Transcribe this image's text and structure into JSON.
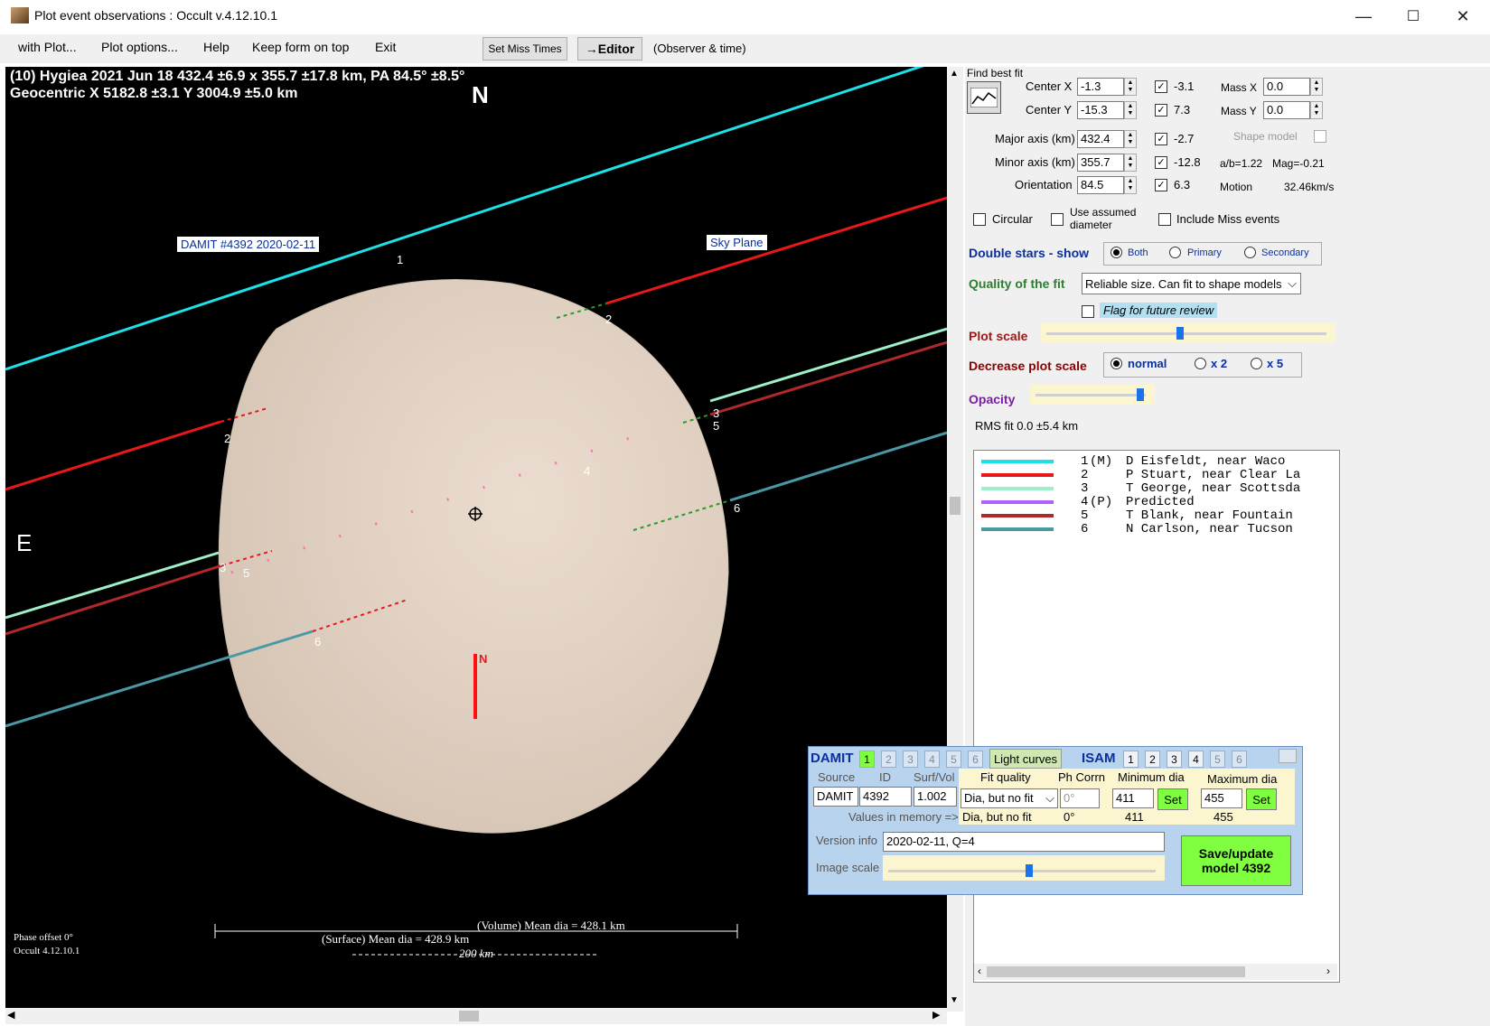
{
  "window": {
    "title": "Plot event observations : Occult v.4.12.10.1",
    "controls": [
      "—",
      "☐",
      "✕"
    ]
  },
  "menu": {
    "items": [
      "with Plot...",
      "Plot options...",
      "Help",
      "Keep form on top",
      "Exit"
    ],
    "set_miss_times": "Set Miss Times",
    "editor": "→Editor",
    "observer_time": "(Observer & time)"
  },
  "plot": {
    "header_line1": "(10) Hygiea  2021 Jun 18   432.4 ±6.9 x 355.7 ±17.8 km, PA 84.5° ±8.5°",
    "header_line2": "Geocentric  X  5182.8 ±3.1  Y 3004.9 ±5.0 km",
    "north": "N",
    "east": "E",
    "damit_label": "DAMIT #4392 2020-02-11",
    "sky_plane_label": "Sky Plane",
    "chord_labels": [
      "1",
      "2",
      "2",
      "3",
      "5",
      "3",
      "5",
      "6",
      "6",
      "4"
    ],
    "shape_north": "N",
    "phase_offset": "Phase offset 0°",
    "version": "Occult 4.12.10.1",
    "volume_mean": "(Volume) Mean dia = 428.1 km",
    "surface_mean": "(Surface) Mean dia = 428.9 km",
    "scale_label": "200 km",
    "colors": {
      "chord1": "#1ee0e8",
      "chord2": "#e81818",
      "chord3": "#9ef0c8",
      "chord5": "#b02828",
      "chord6": "#4a9aa6",
      "body": "#e6d6c8"
    }
  },
  "fit": {
    "find_best_fit": "Find best fit",
    "center_x_label": "Center X",
    "center_x": "-1.3",
    "center_y_label": "Center Y",
    "center_y": "-15.3",
    "major_label": "Major axis (km)",
    "major": "432.4",
    "minor_label": "Minor axis (km)",
    "minor": "355.7",
    "orientation_label": "Orientation",
    "orientation": "84.5",
    "check_values": [
      "-3.1",
      "7.3",
      "-2.7",
      "-12.8",
      "6.3"
    ],
    "mass_x_label": "Mass X",
    "mass_x": "0.0",
    "mass_y_label": "Mass Y",
    "mass_y": "0.0",
    "shape_model": "Shape model",
    "ab_ratio": "a/b=1.22",
    "mag": "Mag=-0.21",
    "motion_label": "Motion",
    "motion": "32.46km/s",
    "circular": "Circular",
    "use_assumed": "Use assumed",
    "diameter": "diameter",
    "include_miss": "Include Miss events",
    "double_stars_label": "Double stars - show",
    "double_options": [
      "Both",
      "Primary",
      "Secondary"
    ],
    "quality_label": "Quality of the fit",
    "quality_value": "Reliable size. Can fit to shape models",
    "flag_review": "Flag for future review",
    "plot_scale": "Plot scale",
    "decrease_label": "Decrease plot scale",
    "decrease_options": [
      "normal",
      "x 2",
      "x 5"
    ],
    "opacity": "Opacity",
    "rms": "RMS fit 0.0 ±5.4 km"
  },
  "legend": [
    {
      "num": "1",
      "tag": "(M)",
      "name": "D Eisfeldt, near Waco",
      "color": "#1ee0e8"
    },
    {
      "num": "2",
      "tag": "",
      "name": "P Stuart, near Clear La",
      "color": "#e81818"
    },
    {
      "num": "3",
      "tag": "",
      "name": "T George, near Scottsda",
      "color": "#9ef0c8"
    },
    {
      "num": "4",
      "tag": "(P)",
      "name": "Predicted",
      "color": "#b060ff"
    },
    {
      "num": "5",
      "tag": "",
      "name": "T Blank, near Fountain",
      "color": "#b02828"
    },
    {
      "num": "6",
      "tag": "",
      "name": "N Carlson, near Tucson",
      "color": "#4a9aa6"
    }
  ],
  "damit": {
    "title": "DAMIT",
    "tabs": [
      "1",
      "2",
      "3",
      "4",
      "5",
      "6"
    ],
    "light_curves": "Light curves",
    "isam": "ISAM",
    "isam_tabs": [
      "1",
      "2",
      "3",
      "4",
      "5",
      "6"
    ],
    "source_label": "Source",
    "id_label": "ID",
    "surf_vol_label": "Surf/Vol",
    "fit_quality_label": "Fit quality",
    "ph_corr_label": "Ph Corrn",
    "min_dia_label": "Minimum dia",
    "max_dia_label": "Maximum dia",
    "source": "DAMIT",
    "id": "4392",
    "surf_vol": "1.002",
    "fit_quality": "Dia, but no fit",
    "ph_corr": "0°",
    "min_dia": "411",
    "max_dia": "455",
    "set": "Set",
    "values_in_memory": "Values in memory =>",
    "mem_fit_quality": "Dia, but no fit",
    "mem_ph_corr": "0°",
    "mem_min": "411",
    "mem_max": "455",
    "version_info_label": "Version info",
    "version_info": "2020-02-11, Q=4",
    "image_scale": "Image scale",
    "save_button": "Save/update model 4392"
  }
}
